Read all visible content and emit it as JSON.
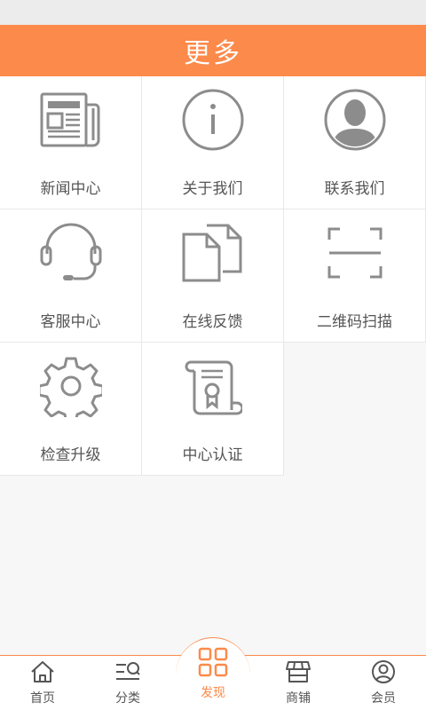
{
  "header": {
    "title": "更多"
  },
  "grid": {
    "items": [
      {
        "label": "新闻中心",
        "icon": "newspaper-icon"
      },
      {
        "label": "关于我们",
        "icon": "info-icon"
      },
      {
        "label": "联系我们",
        "icon": "contact-person-icon"
      },
      {
        "label": "客服中心",
        "icon": "headset-icon"
      },
      {
        "label": "在线反馈",
        "icon": "feedback-documents-icon"
      },
      {
        "label": "二维码扫描",
        "icon": "qr-scan-icon"
      },
      {
        "label": "检查升级",
        "icon": "gear-icon"
      },
      {
        "label": "中心认证",
        "icon": "certificate-scroll-icon"
      }
    ]
  },
  "tabbar": {
    "accent": "#fc8a4a",
    "tabs": [
      {
        "label": "首页",
        "icon": "home-icon"
      },
      {
        "label": "分类",
        "icon": "category-search-icon"
      },
      {
        "label": "发现",
        "icon": "discover-grid-icon",
        "active": true
      },
      {
        "label": "商铺",
        "icon": "shop-icon"
      },
      {
        "label": "会员",
        "icon": "member-icon"
      }
    ]
  }
}
